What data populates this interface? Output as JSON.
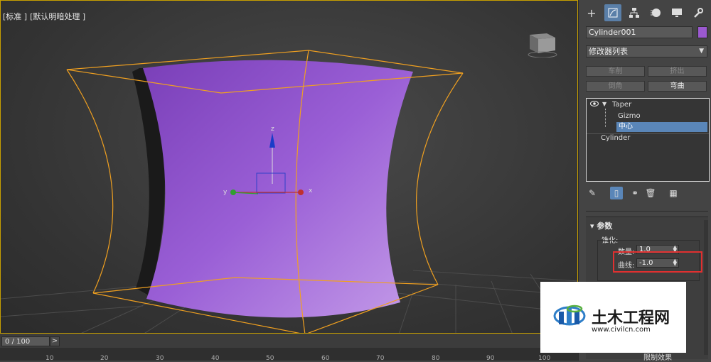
{
  "viewport": {
    "label_left": "[标准 ]",
    "label_right": "[默认明暗处理 ]",
    "gizmo_axes": {
      "z": "z",
      "x": "x",
      "y": "y"
    }
  },
  "timeline": {
    "frame": "0 / 100",
    "next": ">",
    "ticks": [
      "10",
      "20",
      "30",
      "40",
      "50",
      "60",
      "70",
      "80",
      "90",
      "100"
    ]
  },
  "panel": {
    "tabs": [
      {
        "icon": "create-icon"
      },
      {
        "icon": "modify-icon"
      },
      {
        "icon": "hierarchy-icon"
      },
      {
        "icon": "motion-icon"
      },
      {
        "icon": "display-icon"
      },
      {
        "icon": "utilities-icon"
      }
    ],
    "object_name": "Cylinder001",
    "object_color": "#9b59d0",
    "modifier_list": "修改器列表",
    "buttons": {
      "lathe": "车削",
      "extrude": "挤出",
      "chamfer": "倒角",
      "bend": "弯曲"
    },
    "stack": {
      "taper": "Taper",
      "gizmo": "Gizmo",
      "center": "中心",
      "cylinder": "Cylinder"
    },
    "params": {
      "title": "参数",
      "group_label": "锥化:",
      "amount_label": "数量:",
      "amount_value": "1.0",
      "curve_label": "曲线:",
      "curve_value": "-1.0",
      "limit_label": "限制效果"
    }
  },
  "watermark": {
    "brand": "土木工程网",
    "url": "www.civilcn.com"
  }
}
